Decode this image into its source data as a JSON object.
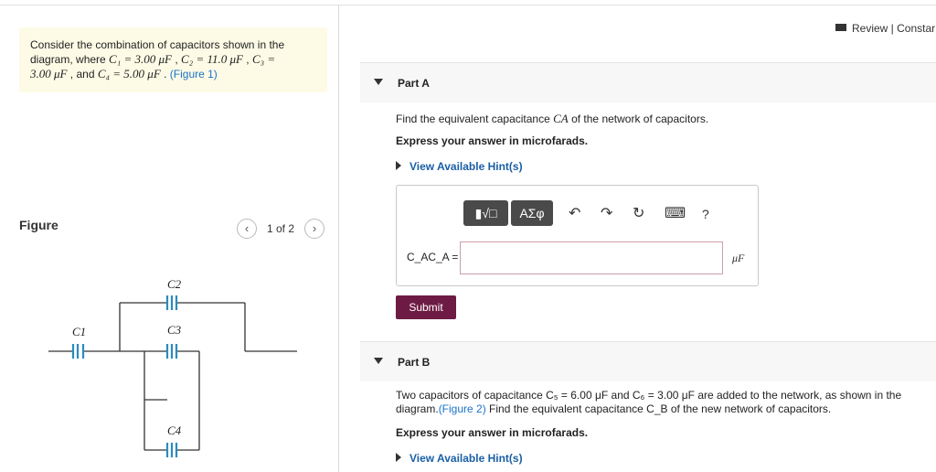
{
  "header": {
    "review_label": "Review | Constar"
  },
  "problem": {
    "line1": "Consider the combination of capacitors shown in the",
    "line2_pre": "diagram, where ",
    "c1": "C₁ = 3.00 μF",
    "c2": "C₂ = 11.0 μF",
    "c3": "C₃ =",
    "line3_val": "3.00 μF",
    "line3_and": " , and ",
    "c4": "C₄ = 5.00 μF",
    "figure_link": "(Figure 1)"
  },
  "figure": {
    "label": "Figure",
    "page_indicator": "1 of 2",
    "prev_glyph": "‹",
    "next_glyph": "›",
    "capacitor_labels": [
      "C1",
      "C2",
      "C3",
      "C4"
    ]
  },
  "part_a": {
    "title": "Part A",
    "question_pre": "Find the equivalent capacitance ",
    "symbol": "CA",
    "question_post": " of the network of capacitors.",
    "instruction": "Express your answer in microfarads.",
    "hint_label": "View Available Hint(s)",
    "toolbar": {
      "templates_label": "▮√□",
      "symbols_label": "ΑΣφ",
      "undo_glyph": "↶",
      "redo_glyph": "↷",
      "reset_glyph": "↻",
      "keyboard_glyph": "⌨",
      "help_glyph": "?"
    },
    "answer_label": "C_AC_A =",
    "answer_value": "",
    "unit": "μF",
    "submit_label": "Submit"
  },
  "part_b": {
    "title": "Part B",
    "question_l1": "Two capacitors of capacitance C₅ = 6.00 μF and C₆ = 3.00 μF are added to the network, as shown in the",
    "question_l2_pre": "diagram.",
    "figure_link": "(Figure 2)",
    "question_l2_post": " Find the equivalent capacitance C_B of the new network of capacitors.",
    "instruction": "Express your answer in microfarads.",
    "hint_label": "View Available Hint(s)"
  },
  "colors": {
    "link": "#1a73c8",
    "submit_bg": "#6d1b44",
    "capacitor_plate": "#2a8bbf",
    "problem_bg": "#fdfbe6"
  }
}
